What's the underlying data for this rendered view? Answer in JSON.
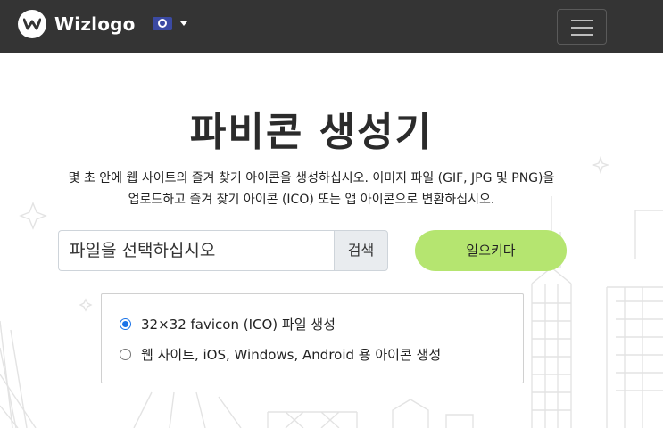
{
  "navbar": {
    "brand_name": "Wizlogo",
    "language_icon": "globe-flag-icon",
    "menu_icon": "hamburger-icon"
  },
  "main": {
    "title": "파비콘 생성기",
    "description_line1": "몇 초 안에 웹 사이트의 즐겨 찾기 아이콘을 생성하십시오. 이미지 파일 (GIF, JPG 및 PNG)을",
    "description_line2": "업로드하고 즐겨 찾기 아이콘 (ICO) 또는 앱 아이콘으로 변환하십시오.",
    "file_placeholder": "파일을 선택하십시오",
    "browse_label": "검색",
    "generate_label": "일으키다"
  },
  "options": {
    "items": [
      {
        "label": "32×32 favicon (ICO) 파일 생성",
        "checked": true
      },
      {
        "label": "웹 사이트, iOS, Windows, Android 용 아이콘 생성",
        "checked": false
      }
    ]
  },
  "colors": {
    "navbar": "#343434",
    "accent_button": "#b5e570",
    "radio_checked": "#1a73e8"
  }
}
